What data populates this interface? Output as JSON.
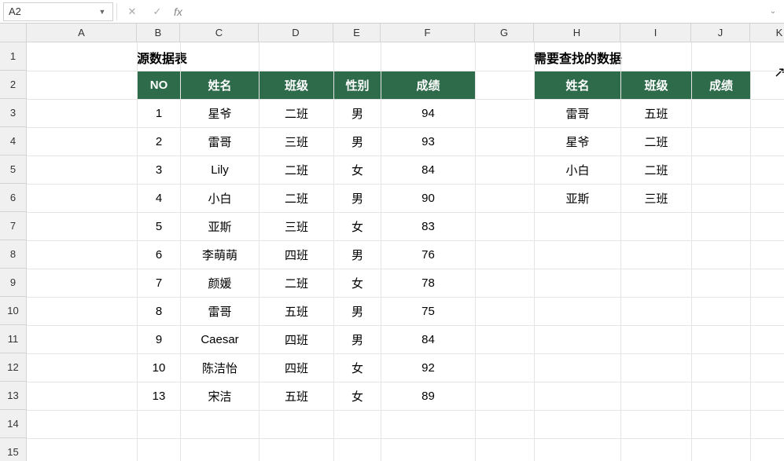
{
  "name_box": "A2",
  "formula_value": "",
  "fx_label": "fx",
  "columns": [
    {
      "label": "A",
      "w": 140
    },
    {
      "label": "B",
      "w": 55
    },
    {
      "label": "C",
      "w": 100
    },
    {
      "label": "D",
      "w": 95
    },
    {
      "label": "E",
      "w": 60
    },
    {
      "label": "F",
      "w": 120
    },
    {
      "label": "G",
      "w": 75
    },
    {
      "label": "H",
      "w": 110
    },
    {
      "label": "I",
      "w": 90
    },
    {
      "label": "J",
      "w": 75
    },
    {
      "label": "K",
      "w": 75
    }
  ],
  "row_count": 15,
  "header_row_h": 36,
  "source_table": {
    "title": "源数据表",
    "headers": [
      "NO",
      "姓名",
      "班级",
      "性别",
      "成绩"
    ],
    "rows": [
      [
        "1",
        "星爷",
        "二班",
        "男",
        "94"
      ],
      [
        "2",
        "雷哥",
        "三班",
        "男",
        "93"
      ],
      [
        "3",
        "Lily",
        "二班",
        "女",
        "84"
      ],
      [
        "4",
        "小白",
        "二班",
        "男",
        "90"
      ],
      [
        "5",
        "亚斯",
        "三班",
        "女",
        "83"
      ],
      [
        "6",
        "李萌萌",
        "四班",
        "男",
        "76"
      ],
      [
        "7",
        "颜媛",
        "二班",
        "女",
        "78"
      ],
      [
        "8",
        "雷哥",
        "五班",
        "男",
        "75"
      ],
      [
        "9",
        "Caesar",
        "四班",
        "男",
        "84"
      ],
      [
        "10",
        "陈洁怡",
        "四班",
        "女",
        "92"
      ],
      [
        "13",
        "宋洁",
        "五班",
        "女",
        "89"
      ]
    ]
  },
  "lookup_table": {
    "title": "需要查找的数据",
    "headers": [
      "姓名",
      "班级",
      "成绩"
    ],
    "rows": [
      [
        "雷哥",
        "五班",
        ""
      ],
      [
        "星爷",
        "二班",
        ""
      ],
      [
        "小白",
        "二班",
        ""
      ],
      [
        "亚斯",
        "三班",
        ""
      ]
    ]
  }
}
